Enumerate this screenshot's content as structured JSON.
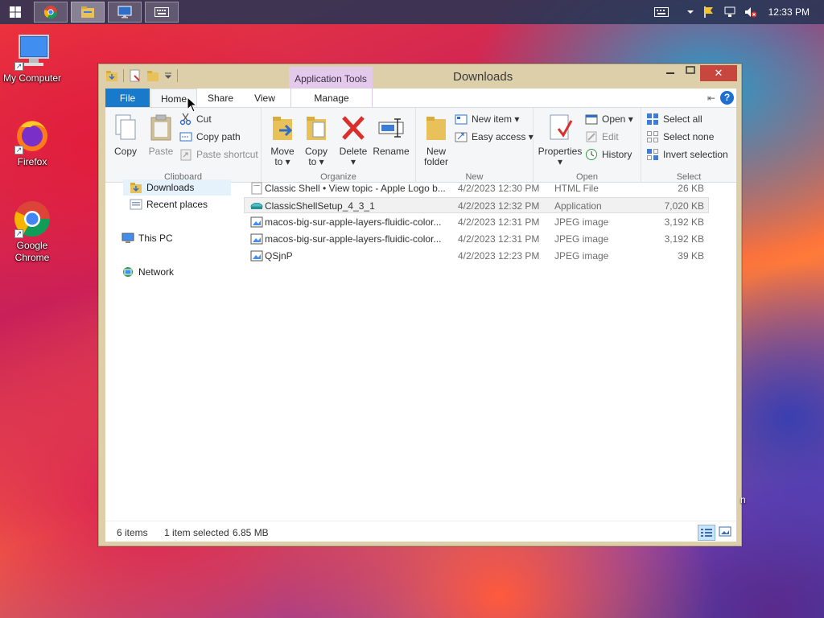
{
  "taskbar": {
    "clock": "12:33 PM",
    "apps": [
      {
        "name": "chrome-icon"
      },
      {
        "name": "file-explorer-icon"
      },
      {
        "name": "remote-desktop-icon"
      },
      {
        "name": "keyboard-icon"
      }
    ]
  },
  "desktop": {
    "icons": [
      {
        "label": "My Computer",
        "icon": "computer-icon"
      },
      {
        "label": "Firefox",
        "icon": "firefox-icon"
      },
      {
        "label": "Google Chrome",
        "icon": "chrome-icon"
      }
    ]
  },
  "window": {
    "title": "Downloads",
    "context_tab": "Application Tools",
    "tabs": {
      "file": "File",
      "home": "Home",
      "share": "Share",
      "view": "View",
      "manage": "Manage"
    },
    "close_glyph": "✕",
    "help_glyph": "?"
  },
  "ribbon": {
    "clipboard": {
      "label": "Clipboard",
      "copy": "Copy",
      "paste": "Paste",
      "cut": "Cut",
      "copy_path": "Copy path",
      "paste_shortcut": "Paste shortcut"
    },
    "organize": {
      "label": "Organize",
      "move_to": "Move",
      "move_to_2": "to",
      "copy_to": "Copy",
      "copy_to_2": "to",
      "delete": "Delete",
      "rename": "Rename"
    },
    "new": {
      "label": "New",
      "new_folder": "New",
      "new_folder_2": "folder",
      "new_item": "New item",
      "easy_access": "Easy access"
    },
    "open": {
      "label": "Open",
      "properties": "Properties",
      "open": "Open",
      "edit": "Edit",
      "history": "History"
    },
    "select": {
      "label": "Select",
      "select_all": "Select all",
      "select_none": "Select none",
      "invert_selection": "Invert selection"
    }
  },
  "nav": {
    "downloads": "Downloads",
    "recent_places": "Recent places",
    "this_pc": "This PC",
    "network": "Network"
  },
  "files": [
    {
      "name": "Classic Shell • View topic - Apple Logo b...",
      "date": "4/2/2023 12:30 PM",
      "type": "HTML File",
      "size": "26 KB",
      "icon": "html-file-icon"
    },
    {
      "name": "ClassicShellSetup_4_3_1",
      "date": "4/2/2023 12:32 PM",
      "type": "Application",
      "size": "7,020 KB",
      "icon": "shell-app-icon"
    },
    {
      "name": "macos-big-sur-apple-layers-fluidic-color...",
      "date": "4/2/2023 12:31 PM",
      "type": "JPEG image",
      "size": "3,192 KB",
      "icon": "image-file-icon"
    },
    {
      "name": "macos-big-sur-apple-layers-fluidic-color...",
      "date": "4/2/2023 12:31 PM",
      "type": "JPEG image",
      "size": "3,192 KB",
      "icon": "image-file-icon"
    },
    {
      "name": "QSjnP",
      "date": "4/2/2023 12:23 PM",
      "type": "JPEG image",
      "size": "39 KB",
      "icon": "image-file-icon"
    }
  ],
  "status": {
    "items": "6 items",
    "selected": "1 item selected",
    "size": "6.85 MB"
  },
  "stray_text": "n"
}
